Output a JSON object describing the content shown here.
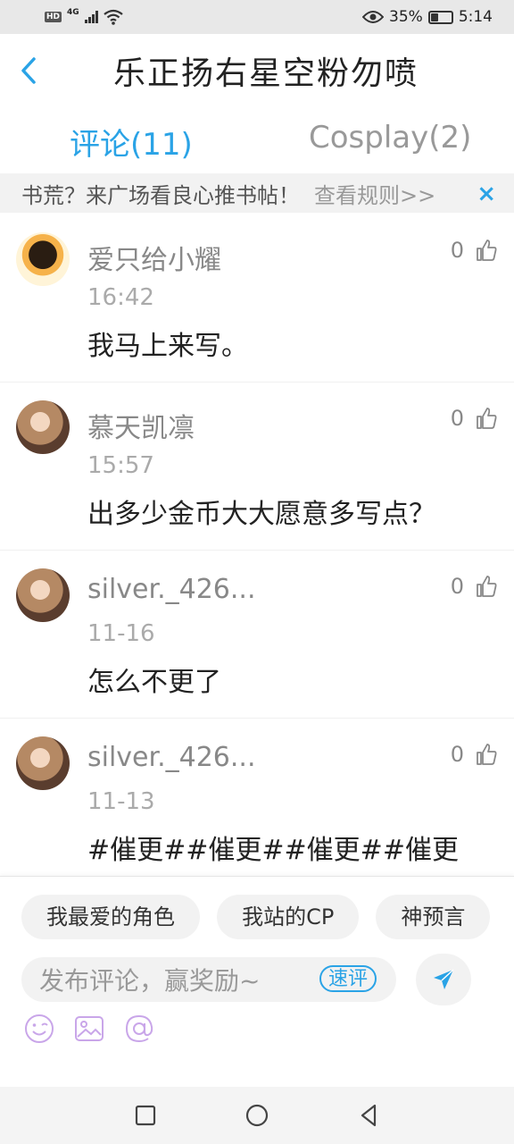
{
  "status_bar": {
    "hd": "HD",
    "network": "4G",
    "battery": "35%",
    "time": "5:14",
    "icons": [
      "hd-icon",
      "signal-icon",
      "wifi-icon",
      "eye-icon",
      "battery-icon"
    ]
  },
  "header": {
    "title": "乐正扬右星空粉勿喷",
    "back_icon": "chevron-left-icon"
  },
  "tabs": {
    "active": "评论(11)",
    "inactive": "Cosplay(2)"
  },
  "banner": {
    "text": "书荒？来广场看良心推书帖！",
    "link": "查看规则>>",
    "close": "×"
  },
  "comments": [
    {
      "user": "爱只给小耀",
      "time": "16:42",
      "text": "我马上来写。",
      "likes": "0"
    },
    {
      "user": "慕天凯凛",
      "time": "15:57",
      "text": "出多少金币大大愿意多写点？",
      "likes": "0"
    },
    {
      "user": "silver._426...",
      "time": "11-16",
      "text": "怎么不更了",
      "likes": "0"
    },
    {
      "user": "silver._426...",
      "time": "11-13",
      "text": "#催更##催更##催更##催更",
      "likes": "0"
    }
  ],
  "composer": {
    "chips": [
      "我最爱的角色",
      "我站的CP",
      "神预言"
    ],
    "placeholder": "发布评论，赢奖励~",
    "quick_label": "速评",
    "tools": [
      "emoji-icon",
      "image-icon",
      "mention-icon"
    ]
  },
  "colors": {
    "accent": "#2aa3e6",
    "tool_icons": "#c9a6e9"
  }
}
